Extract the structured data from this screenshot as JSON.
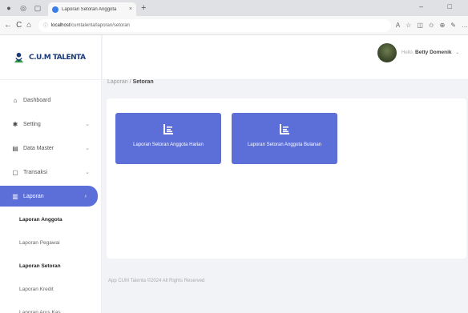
{
  "browser": {
    "tab_title": "Laporan Setoran Anggota",
    "tab_close": "×",
    "new_tab": "+",
    "url_host": "localhost",
    "url_path": "/cumtalenta/laporan/setoran",
    "window_controls": "–  □",
    "back": "←",
    "reload": "C",
    "home": "⌂"
  },
  "brand": {
    "name": "C.U.M TALENTA"
  },
  "header": {
    "greeting": "Hello,",
    "user_name": "Betty Domenik",
    "dropdown": "⌄"
  },
  "sidebar": {
    "items": [
      {
        "label": "Dashboard",
        "icon": "home-icon",
        "glyph": "⌂",
        "chevron": ""
      },
      {
        "label": "Setting",
        "icon": "gear-icon",
        "glyph": "✱",
        "chevron": "⌄"
      },
      {
        "label": "Data Master",
        "icon": "database-icon",
        "glyph": "▤",
        "chevron": "⌄"
      },
      {
        "label": "Transaksi",
        "icon": "document-icon",
        "glyph": "▢",
        "chevron": "⌄"
      },
      {
        "label": "Laporan",
        "icon": "report-icon",
        "glyph": "▥",
        "chevron": ""
      }
    ],
    "submenu": [
      {
        "label": "Laporan Anggota",
        "bold": true
      },
      {
        "label": "Laporan Pegawai",
        "bold": false
      },
      {
        "label": "Laporan Setoran",
        "bold": true
      },
      {
        "label": "Laporan Kredit",
        "bold": false
      },
      {
        "label": "Laporan Arus Kas",
        "bold": false
      }
    ]
  },
  "breadcrumb": {
    "parent": "Laporan",
    "separator": "/",
    "current": "Setoran"
  },
  "tiles": [
    {
      "label": "Laporan Setoran Anggota Harian",
      "icon": "report-icon"
    },
    {
      "label": "Laporan Setoran Anggota Bulanan",
      "icon": "report-icon"
    }
  ],
  "footer": {
    "text": "App CUM Talenta ©2024 All Rights Reserved"
  },
  "colors": {
    "primary": "#5c6fd9",
    "brand": "#1d3b7a"
  }
}
